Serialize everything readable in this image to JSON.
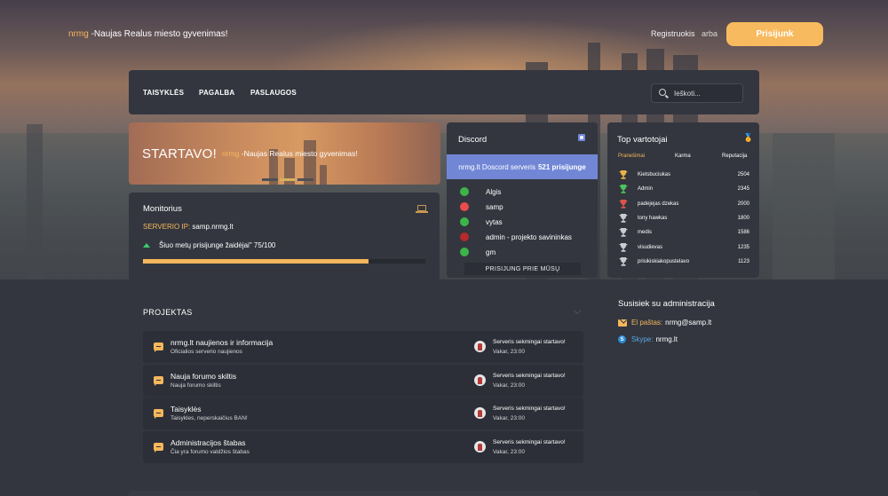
{
  "header": {
    "brand_accent": "nrmg",
    "brand_tagline": " -Naujas Realus miesto gyvenimas!",
    "register": "Registruokis",
    "or": "arba",
    "login": "Prisijunk"
  },
  "nav": {
    "items": [
      "TAISYKLĖS",
      "PAGALBA",
      "PASLAUGOS"
    ],
    "search_placeholder": "Ieškoti..."
  },
  "banner": {
    "title": "STARTAVO!",
    "sub_accent": "nrmg",
    "sub_text": " -Naujas Realus miesto gyvenimas!"
  },
  "monitor": {
    "title": "Monitorius",
    "ip_label": "SERVERIO IP:",
    "ip_value": " samp.nrmg.lt",
    "players_text": "Šiuo metų prisijunge žaidėjai\" 75/100",
    "players_online": 75,
    "players_max": 100,
    "progress_fill": 0.8
  },
  "discord": {
    "title": "Discord",
    "banner_text": "nrmg.lt Doscord serveris",
    "banner_count": "521 prisijunge",
    "members": [
      {
        "name": "Algis",
        "status_color": "#3db44a"
      },
      {
        "name": "samp",
        "status_color": "#e84c4c"
      },
      {
        "name": "vytas",
        "status_color": "#3db44a"
      },
      {
        "name": "admin - projekto savininkas",
        "status_color": "#b52a2a"
      },
      {
        "name": "gm",
        "status_color": "#3db44a"
      }
    ],
    "join_button": "PRISIJUNG PRIE MŪSŲ"
  },
  "topusers": {
    "title": "Top vartotojai",
    "tabs": [
      "Pranešimai",
      "Karma",
      "Reputacija"
    ],
    "users": [
      {
        "name": "Kietsbuciukas",
        "score": "2504",
        "cup": "gold"
      },
      {
        "name": "Admin",
        "score": "2345",
        "cup": "green"
      },
      {
        "name": "padejejas dzekas",
        "score": "2000",
        "cup": "red"
      },
      {
        "name": "tony hawkas",
        "score": "1800",
        "cup": "silver"
      },
      {
        "name": "medis",
        "score": "1586",
        "cup": "silver"
      },
      {
        "name": "visudievas",
        "score": "1235",
        "cup": "silver"
      },
      {
        "name": "prisikiskiakopustelavo",
        "score": "1123",
        "cup": "silver"
      }
    ]
  },
  "projektas": {
    "title": "PROJEKTAS",
    "forums": [
      {
        "title": "nrmg.lt naujienos ir informacija",
        "sub": "Oficialios serverio naujienos",
        "last": "Serveris sekmingai startavo!",
        "time": "Vakar, 23:00"
      },
      {
        "title": "Nauja forumo skiltis",
        "sub": "Nauja forumo skiltis",
        "last": "Serveris sekmingai startavo!",
        "time": "Vakar, 23:00"
      },
      {
        "title": "Taisyklės",
        "sub": "Taisykles, neperskaičius BAN!",
        "last": "Serveris sekmingai startavo!",
        "time": "Vakar, 23:00"
      },
      {
        "title": "Administracijos štabas",
        "sub": "Čia yra forumo valdžios štabas",
        "last": "Serveris sekmingai startavo!",
        "time": "Vakar, 23:00"
      }
    ]
  },
  "contact": {
    "title": "Susisiek su administracija",
    "email_label": "El paštas:",
    "email_value": "nrmg@samp.lt",
    "skype_label": "Skype:",
    "skype_value": "nrmg.lt"
  },
  "colors": {
    "accent": "#f6b75c",
    "panel": "#33363f",
    "discord": "#7187d6"
  }
}
